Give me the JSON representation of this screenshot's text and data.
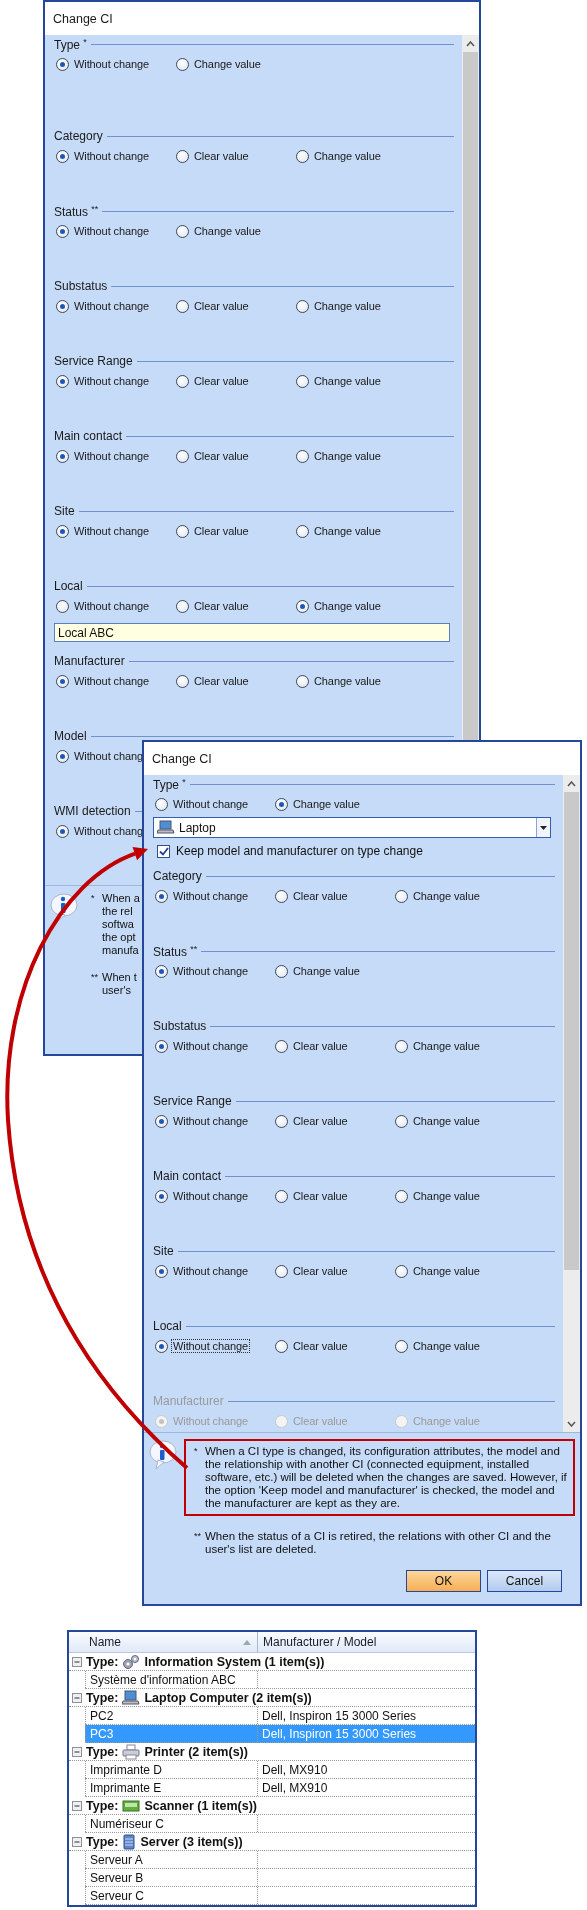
{
  "dialogs": [
    {
      "title": "Change CI",
      "sections": [
        {
          "label": "Type $^{*}$",
          "kind": "type",
          "disabled": false,
          "options": [
            {
              "label": "Without change",
              "selected": true
            },
            {
              "label": "Change value",
              "selected": false
            }
          ]
        },
        {
          "label": "Category",
          "kind": "plain",
          "disabled": false,
          "options": [
            {
              "label": "Without change",
              "selected": true
            },
            {
              "label": "Clear value",
              "selected": false
            },
            {
              "label": "Change value",
              "selected": false
            }
          ]
        },
        {
          "label": "Status $^{**}$",
          "kind": "plain",
          "disabled": false,
          "options": [
            {
              "label": "Without change",
              "selected": true
            },
            {
              "label": "Change value",
              "selected": false
            }
          ]
        },
        {
          "label": "Substatus",
          "kind": "plain",
          "disabled": false,
          "options": [
            {
              "label": "Without change",
              "selected": true
            },
            {
              "label": "Clear value",
              "selected": false
            },
            {
              "label": "Change value",
              "selected": false
            }
          ]
        },
        {
          "label": "Service Range",
          "kind": "plain",
          "disabled": false,
          "options": [
            {
              "label": "Without change",
              "selected": true
            },
            {
              "label": "Clear value",
              "selected": false
            },
            {
              "label": "Change value",
              "selected": false
            }
          ]
        },
        {
          "label": "Main contact",
          "kind": "plain",
          "disabled": false,
          "options": [
            {
              "label": "Without change",
              "selected": true
            },
            {
              "label": "Clear value",
              "selected": false
            },
            {
              "label": "Change value",
              "selected": false
            }
          ]
        },
        {
          "label": "Site",
          "kind": "plain",
          "disabled": false,
          "options": [
            {
              "label": "Without change",
              "selected": true
            },
            {
              "label": "Clear value",
              "selected": false
            },
            {
              "label": "Change value",
              "selected": false
            }
          ]
        },
        {
          "label": "Local",
          "kind": "plain",
          "disabled": false,
          "options": [
            {
              "label": "Without change",
              "selected": false
            },
            {
              "label": "Clear value",
              "selected": false
            },
            {
              "label": "Change value",
              "selected": true
            }
          ],
          "field": {
            "value": "Local ABC"
          }
        },
        {
          "label": "Manufacturer",
          "kind": "plain",
          "disabled": false,
          "options": [
            {
              "label": "Without change",
              "selected": true
            },
            {
              "label": "Clear value",
              "selected": false
            },
            {
              "label": "Change value",
              "selected": false
            }
          ]
        },
        {
          "label": "Model",
          "kind": "plain",
          "disabled": false,
          "options": [
            {
              "label": "Without chang",
              "selected": true
            }
          ]
        },
        {
          "label": "WMI detection",
          "kind": "plain",
          "disabled": false,
          "options": [
            {
              "label": "Without chang",
              "selected": true
            }
          ]
        }
      ],
      "info": [
        {
          "bullet": "*",
          "lines": [
            "When a",
            "the rel",
            "softwa",
            "the opt",
            "manufa"
          ],
          "highlighted": false
        },
        {
          "bullet": "**",
          "lines": [
            "When t",
            "user's"
          ],
          "highlighted": false
        }
      ]
    },
    {
      "title": "Change CI",
      "sections": [
        {
          "label": "Type $^{*}$",
          "kind": "type",
          "disabled": false,
          "options": [
            {
              "label": "Without change",
              "selected": false
            },
            {
              "label": "Change value",
              "selected": true
            }
          ],
          "combobox": {
            "value": "Laptop"
          },
          "checkbox": {
            "label": "Keep model and manufacturer on type change",
            "checked": true
          }
        },
        {
          "label": "Category",
          "kind": "plain",
          "disabled": false,
          "options": [
            {
              "label": "Without change",
              "selected": true
            },
            {
              "label": "Clear value",
              "selected": false
            },
            {
              "label": "Change value",
              "selected": false
            }
          ]
        },
        {
          "label": "Status $^{**}$",
          "kind": "plain",
          "disabled": false,
          "options": [
            {
              "label": "Without change",
              "selected": true
            },
            {
              "label": "Change value",
              "selected": false
            }
          ]
        },
        {
          "label": "Substatus",
          "kind": "plain",
          "disabled": false,
          "options": [
            {
              "label": "Without change",
              "selected": true
            },
            {
              "label": "Clear value",
              "selected": false
            },
            {
              "label": "Change value",
              "selected": false
            }
          ]
        },
        {
          "label": "Service Range",
          "kind": "plain",
          "disabled": false,
          "options": [
            {
              "label": "Without change",
              "selected": true
            },
            {
              "label": "Clear value",
              "selected": false
            },
            {
              "label": "Change value",
              "selected": false
            }
          ]
        },
        {
          "label": "Main contact",
          "kind": "plain",
          "disabled": false,
          "options": [
            {
              "label": "Without change",
              "selected": true
            },
            {
              "label": "Clear value",
              "selected": false
            },
            {
              "label": "Change value",
              "selected": false
            }
          ]
        },
        {
          "label": "Site",
          "kind": "plain",
          "disabled": false,
          "options": [
            {
              "label": "Without change",
              "selected": true
            },
            {
              "label": "Clear value",
              "selected": false
            },
            {
              "label": "Change value",
              "selected": false
            }
          ]
        },
        {
          "label": "Local",
          "kind": "plain",
          "disabled": false,
          "options": [
            {
              "label": "Without change",
              "selected": true,
              "focused": true
            },
            {
              "label": "Clear value",
              "selected": false,
              "focused": false
            },
            {
              "label": "Change value",
              "selected": false,
              "focused": false
            }
          ]
        },
        {
          "label": "Manufacturer",
          "kind": "plain",
          "disabled": true,
          "options": [
            {
              "label": "Without change",
              "selected": true
            },
            {
              "label": "Clear value",
              "selected": false
            },
            {
              "label": "Change value",
              "selected": false
            }
          ]
        }
      ],
      "info": [
        {
          "bullet": "*",
          "text": "When a CI type is changed, its configuration attributes, the model and the relationship with another CI (connected equipment, installed software, etc.) will be deleted when the changes are saved. However, if the option 'Keep model and manufacturer' is checked, the model and the manufacturer are kept as they are.",
          "highlighted": true
        },
        {
          "bullet": "**",
          "text": "When the status of a CI is retired, the relations with other CI and the user's list are deleted.",
          "highlighted": false
        }
      ],
      "buttons": [
        {
          "label": "OK",
          "kind": "default"
        },
        {
          "label": "Cancel",
          "kind": "normal"
        }
      ]
    }
  ],
  "table": {
    "columns": [
      {
        "label": "Name",
        "sorted": true
      },
      {
        "label": "Manufacturer / Model",
        "sorted": false
      }
    ],
    "groups": [
      {
        "prefix": "Type:",
        "name": "Information System (1 item(s))",
        "kind": "information-system",
        "expanded": true,
        "rows": [
          {
            "name": "Système d'information ABC",
            "selected": false
          }
        ]
      },
      {
        "prefix": "Type:",
        "name": "Laptop Computer (2 item(s))",
        "kind": "laptop",
        "expanded": true,
        "rows": [
          {
            "name": "PC2",
            "manufacturer_model": "Dell, Inspiron 15 3000 Series",
            "selected": false
          },
          {
            "name": "PC3",
            "manufacturer_model": "Dell, Inspiron 15 3000 Series",
            "selected": true
          }
        ]
      },
      {
        "prefix": "Type:",
        "name": "Printer (2 item(s))",
        "kind": "printer",
        "expanded": true,
        "rows": [
          {
            "name": "Imprimante D",
            "manufacturer_model": "Dell, MX910",
            "selected": false
          },
          {
            "name": "Imprimante E",
            "manufacturer_model": "Dell, MX910",
            "selected": false
          }
        ]
      },
      {
        "prefix": "Type:",
        "name": "Scanner (1 item(s))",
        "kind": "scanner",
        "expanded": true,
        "rows": [
          {
            "name": "Numériseur C",
            "selected": false
          }
        ]
      },
      {
        "prefix": "Type:",
        "name": "Server (3 item(s))",
        "kind": "server",
        "expanded": true,
        "rows": [
          {
            "name": "Serveur A",
            "selected": false
          },
          {
            "name": "Serveur B",
            "selected": false
          },
          {
            "name": "Serveur C",
            "selected": false
          }
        ]
      }
    ]
  }
}
